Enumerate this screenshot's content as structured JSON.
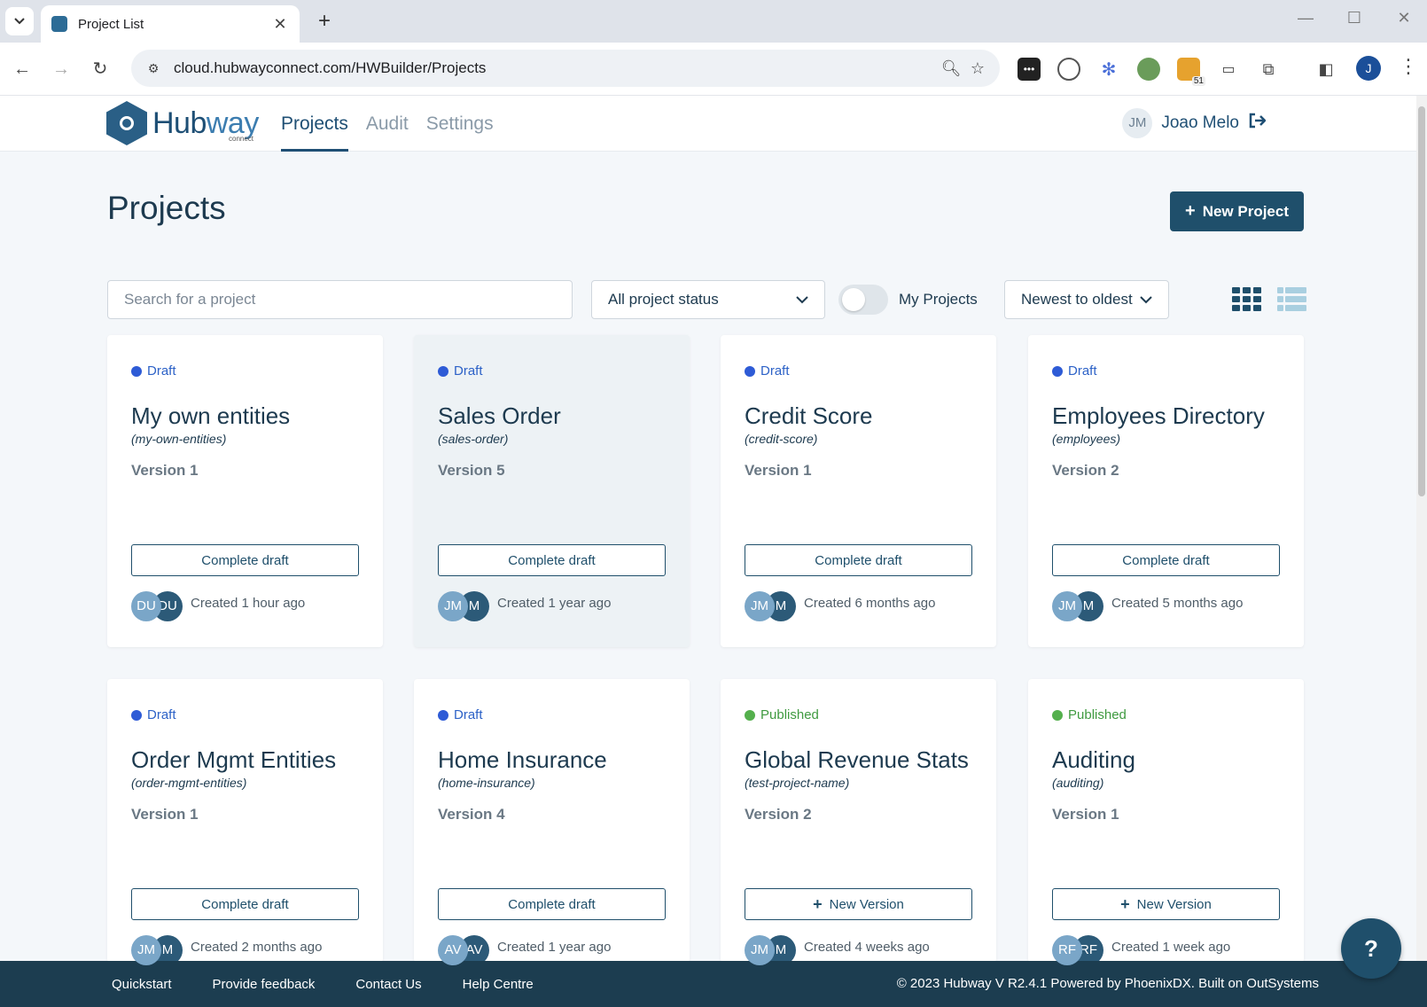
{
  "browser": {
    "tab_title": "Project List",
    "url": "cloud.hubwayconnect.com/HWBuilder/Projects",
    "profile_initial": "J",
    "extension_badge": "51"
  },
  "header": {
    "logo_text_1": "Hub",
    "logo_text_2": "way",
    "logo_sub": "connect",
    "nav": [
      "Projects",
      "Audit",
      "Settings"
    ],
    "user_initials": "JM",
    "user_name": "Joao Melo"
  },
  "page": {
    "title": "Projects",
    "new_project_label": "New Project"
  },
  "filters": {
    "search_placeholder": "Search for a project",
    "status_value": "All project status",
    "my_projects_label": "My Projects",
    "my_projects_on": false,
    "sort_value": "Newest to oldest"
  },
  "projects": [
    {
      "status": "Draft",
      "title": "My own entities",
      "slug": "(my-own-entities)",
      "version": "Version 1",
      "action": "Complete draft",
      "avatar1": "DU",
      "avatar2": "DU",
      "created": "Created 1 hour ago"
    },
    {
      "status": "Draft",
      "title": "Sales Order",
      "slug": "(sales-order)",
      "version": "Version 5",
      "action": "Complete draft",
      "avatar1": "JM",
      "avatar2": "M",
      "created": "Created 1 year ago"
    },
    {
      "status": "Draft",
      "title": "Credit Score",
      "slug": "(credit-score)",
      "version": "Version 1",
      "action": "Complete draft",
      "avatar1": "JM",
      "avatar2": "M",
      "created": "Created 6 months ago"
    },
    {
      "status": "Draft",
      "title": "Employees Directory",
      "slug": "(employees)",
      "version": "Version 2",
      "action": "Complete draft",
      "avatar1": "JM",
      "avatar2": "M",
      "created": "Created 5 months ago"
    },
    {
      "status": "Draft",
      "title": "Order Mgmt Entities",
      "slug": "(order-mgmt-entities)",
      "version": "Version 1",
      "action": "Complete draft",
      "avatar1": "JM",
      "avatar2": "M",
      "created": "Created 2 months ago"
    },
    {
      "status": "Draft",
      "title": "Home Insurance",
      "slug": "(home-insurance)",
      "version": "Version 4",
      "action": "Complete draft",
      "avatar1": "AV",
      "avatar2": "AV",
      "created": "Created 1 year ago"
    },
    {
      "status": "Published",
      "title": "Global Revenue Stats",
      "slug": "(test-project-name)",
      "version": "Version 2",
      "action": "New Version",
      "avatar1": "JM",
      "avatar2": "M",
      "created": "Created 4 weeks ago"
    },
    {
      "status": "Published",
      "title": "Auditing",
      "slug": "(auditing)",
      "version": "Version 1",
      "action": "New Version",
      "avatar1": "RF",
      "avatar2": "RF",
      "created": "Created 1 week ago"
    }
  ],
  "footer": {
    "links": [
      "Quickstart",
      "Provide feedback",
      "Contact Us",
      "Help Centre"
    ],
    "copyright": "© 2023 Hubway V R2.4.1 Powered by PhoenixDX. Built on OutSystems"
  },
  "help_label": "?"
}
